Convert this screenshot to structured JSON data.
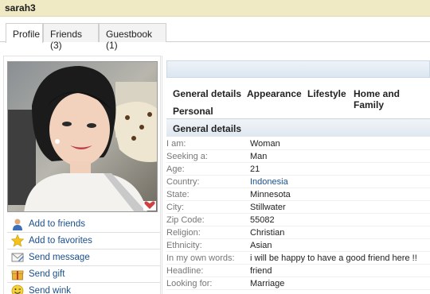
{
  "header": {
    "username": "sarah3"
  },
  "tabs": [
    {
      "label": "Profile"
    },
    {
      "label": "Friends (3)"
    },
    {
      "label": "Guestbook (1)"
    }
  ],
  "actions": [
    {
      "label": "Add to friends",
      "icon": "person-add-icon"
    },
    {
      "label": "Add to favorites",
      "icon": "star-icon"
    },
    {
      "label": "Send message",
      "icon": "envelope-icon"
    },
    {
      "label": "Send gift",
      "icon": "gift-icon"
    },
    {
      "label": "Send wink",
      "icon": "smiley-icon"
    }
  ],
  "section_nav": [
    "General details",
    "Appearance",
    "Lifestyle",
    "Home and Family",
    "Personal"
  ],
  "section_title": "General details",
  "details": [
    {
      "key": "I am:",
      "value": "Woman"
    },
    {
      "key": "Seeking a:",
      "value": "Man"
    },
    {
      "key": "Age:",
      "value": "21"
    },
    {
      "key": "Country:",
      "value": "Indonesia"
    },
    {
      "key": "State:",
      "value": "Minnesota"
    },
    {
      "key": "City:",
      "value": "Stillwater"
    },
    {
      "key": "Zip Code:",
      "value": "55082"
    },
    {
      "key": "Religion:",
      "value": "Christian"
    },
    {
      "key": "Ethnicity:",
      "value": "Asian"
    },
    {
      "key": "In my own words:",
      "value": "i will be happy to have a good friend here !!"
    },
    {
      "key": "Headline:",
      "value": "friend"
    },
    {
      "key": "Looking for:",
      "value": "Marriage"
    }
  ],
  "colors": {
    "header_bg": "#efe9c4",
    "link": "#1a4f8c",
    "accent_bar": "#dbe6f1"
  }
}
